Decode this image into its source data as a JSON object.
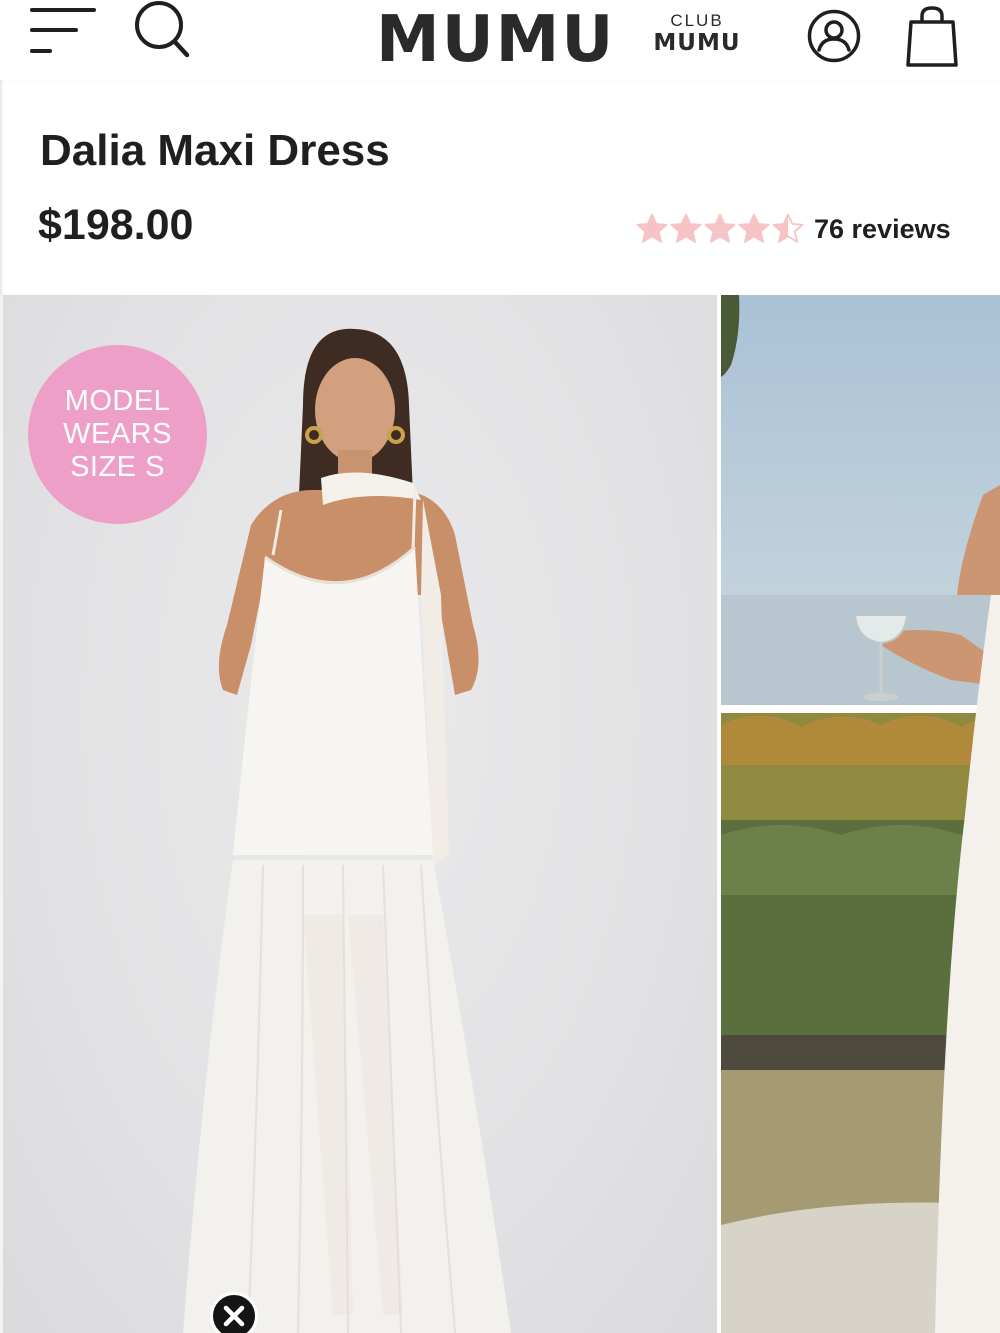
{
  "header": {
    "brand": "MUMU",
    "club_line1": "CLUB",
    "club_line2": "MUMU"
  },
  "product": {
    "title": "Dalia Maxi Dress",
    "price": "$198.00",
    "rating": 4.5,
    "reviews_label": "76 reviews"
  },
  "gallery": {
    "badge_lines": [
      "MODEL",
      "WEARS",
      "SIZE S"
    ]
  },
  "colors": {
    "star": "#f6c3c6",
    "badge": "#ee9fc7",
    "text": "#1f1f1f"
  },
  "icons": [
    "hamburger-menu-icon",
    "search-icon",
    "account-icon",
    "shopping-bag-icon",
    "star-icon",
    "close-icon"
  ]
}
